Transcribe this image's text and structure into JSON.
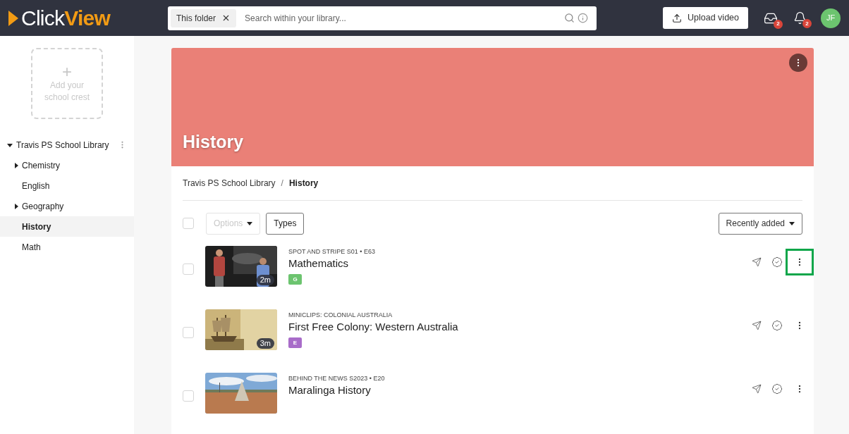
{
  "header": {
    "logo": {
      "left": "Click",
      "right": "View"
    },
    "search": {
      "scope_chip": "This folder",
      "placeholder": "Search within your library..."
    },
    "upload_button": "Upload video",
    "inbox_badge": "2",
    "notifications_badge": "2",
    "avatar": "JF"
  },
  "sidebar": {
    "crest": {
      "plus": "+",
      "label": "Add your school crest"
    },
    "tree": [
      {
        "label": "Travis PS School Library",
        "expanded": true,
        "selected": false,
        "children": [
          {
            "label": "Chemistry",
            "expandable": true,
            "selected": false
          },
          {
            "label": "English",
            "expandable": false,
            "selected": false
          },
          {
            "label": "Geography",
            "expandable": true,
            "selected": false
          },
          {
            "label": "History",
            "expandable": false,
            "selected": true
          },
          {
            "label": "Math",
            "expandable": false,
            "selected": false
          }
        ]
      }
    ]
  },
  "banner": {
    "title": "History"
  },
  "breadcrumb": [
    {
      "label": "Travis PS School Library",
      "current": false
    },
    {
      "separator": "/",
      "label": "History",
      "current": true
    }
  ],
  "toolbar": {
    "select_all_checked": false,
    "options": "Options",
    "options_disabled": true,
    "types": "Types",
    "sort": "Recently added"
  },
  "videos": [
    {
      "series": "SPOT AND STRIPE S01 • E63",
      "title": "Mathematics",
      "duration": "2m",
      "rating": "G",
      "color": "#6cc46f",
      "checked": false,
      "highlighted": true
    },
    {
      "series": "MINICLIPS: COLONIAL AUSTRALIA",
      "title": "First Free Colony: Western Australia",
      "duration": "3m",
      "rating": "E",
      "color": "#a86cc9",
      "checked": false,
      "highlighted": false
    },
    {
      "series": "BEHIND THE NEWS S2023 • E20",
      "title": "Maralinga History",
      "checked": false,
      "highlighted": false
    }
  ]
}
